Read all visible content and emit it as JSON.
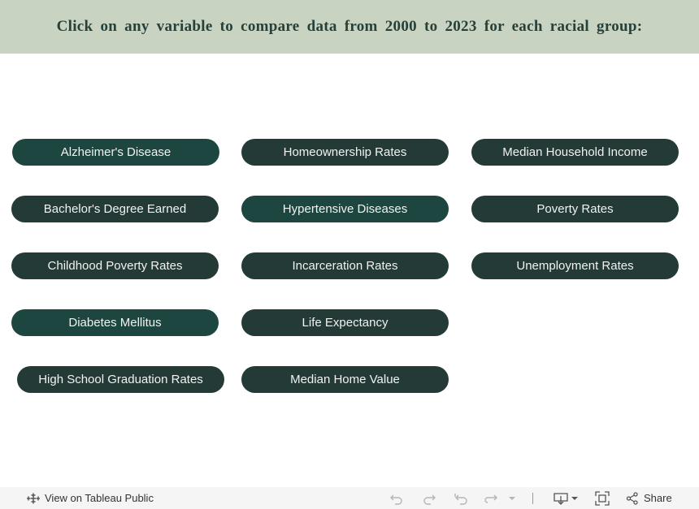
{
  "header": {
    "title": "Click on any variable to compare data from 2000 to 2023 for each racial group:"
  },
  "variables": [
    {
      "label": "Alzheimer's Disease"
    },
    {
      "label": "Homeownership Rates"
    },
    {
      "label": "Median Household Income"
    },
    {
      "label": "Bachelor's Degree Earned"
    },
    {
      "label": "Hypertensive Diseases"
    },
    {
      "label": "Poverty Rates"
    },
    {
      "label": "Childhood Poverty Rates"
    },
    {
      "label": "Incarceration Rates"
    },
    {
      "label": "Unemployment Rates"
    },
    {
      "label": "Diabetes Mellitus"
    },
    {
      "label": "Life Expectancy"
    },
    {
      "label": "High School Graduation Rates"
    },
    {
      "label": "Median Home Value"
    }
  ],
  "toolbar": {
    "view_label": "View on Tableau Public",
    "share_label": "Share"
  },
  "colors": {
    "header_bg": "#c9d3c2",
    "button_bg": "#233a36",
    "button_bg_alt": "#1d4640",
    "button_text": "#f2f2f2"
  }
}
